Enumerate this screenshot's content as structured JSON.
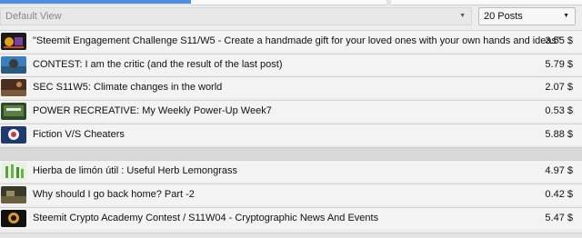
{
  "controls": {
    "view_select": "Default View",
    "posts_select": "20 Posts"
  },
  "posts": [
    {
      "title": "\"Steemit Engagement Challenge S11/W5 - Create a handmade gift for your loved ones with your own hands and ideas\"",
      "payout": "3.55 $"
    },
    {
      "title": "CONTEST: I am the critic (and the result of the last post)",
      "payout": "5.79 $"
    },
    {
      "title": "SEC S11W5: Climate changes in the world",
      "payout": "2.07 $"
    },
    {
      "title": "POWER RECREATIVE: My Weekly Power-Up Week7",
      "payout": "0.53 $"
    },
    {
      "title": "Fiction V/S Cheaters",
      "payout": "5.88 $"
    },
    {
      "title": "Hierba de limón útil : Useful Herb Lemongrass",
      "payout": "4.97 $"
    },
    {
      "title": "Why should I go back home? Part -2",
      "payout": "0.42 $"
    },
    {
      "title": "Steemit Crypto Academy Contest / S11W04 - Cryptographic News And Events",
      "payout": "5.47 $"
    }
  ]
}
